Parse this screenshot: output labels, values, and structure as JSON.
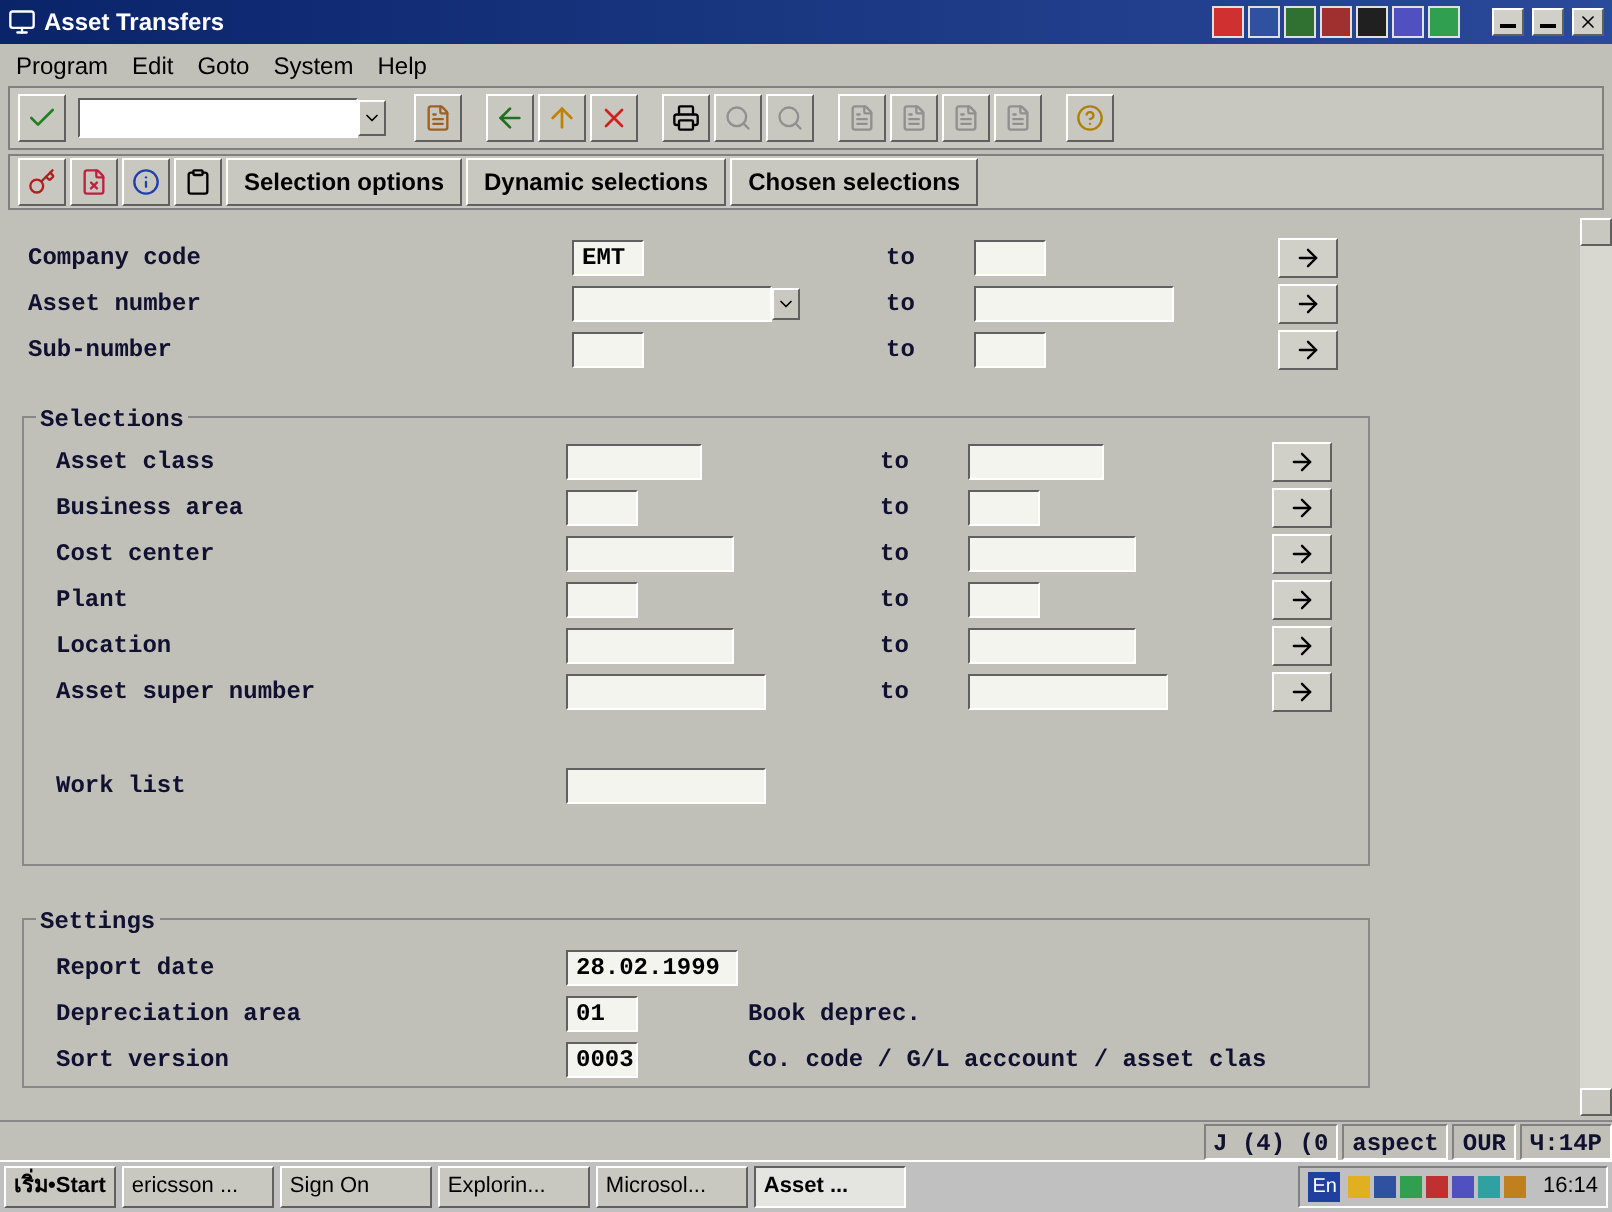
{
  "window": {
    "title": "Asset Transfers"
  },
  "menu": [
    "Program",
    "Edit",
    "Goto",
    "System",
    "Help"
  ],
  "app_toolbar": {
    "buttons": [
      "Selection options",
      "Dynamic selections",
      "Chosen selections"
    ]
  },
  "top_rows": [
    {
      "label": "Company code",
      "low": "EMT",
      "to": "to"
    },
    {
      "label": "Asset number",
      "low": "",
      "to": "to",
      "kind": "dropdown"
    },
    {
      "label": "Sub-number",
      "low": "",
      "to": "to"
    }
  ],
  "selections": {
    "title": "Selections",
    "rows": [
      {
        "label": "Asset class",
        "to": "to"
      },
      {
        "label": "Business area",
        "to": "to"
      },
      {
        "label": "Cost center",
        "to": "to"
      },
      {
        "label": "Plant",
        "to": "to"
      },
      {
        "label": "Location",
        "to": "to"
      },
      {
        "label": "Asset super number",
        "to": "to"
      }
    ],
    "work_list": {
      "label": "Work list"
    }
  },
  "settings": {
    "title": "Settings",
    "rows": [
      {
        "label": "Report date",
        "value": "28.02.1999"
      },
      {
        "label": "Depreciation area",
        "value": "01",
        "text": "Book deprec."
      },
      {
        "label": "Sort version",
        "value": "0003",
        "text": "Co. code / G/L acccount / asset clas"
      }
    ]
  },
  "status_bar": [
    "J (4) (0",
    "aspect",
    "OUR",
    "Ч:14P"
  ],
  "taskbar": {
    "start": "เริ่ม•Start",
    "items": [
      {
        "label": "ericsson ...",
        "selected": false
      },
      {
        "label": "Sign On",
        "selected": false
      },
      {
        "label": "Explorin...",
        "selected": false
      },
      {
        "label": "Microsol...",
        "selected": false
      },
      {
        "label": "Asset ...",
        "selected": true
      }
    ],
    "language": "En",
    "clock": "16:14"
  }
}
